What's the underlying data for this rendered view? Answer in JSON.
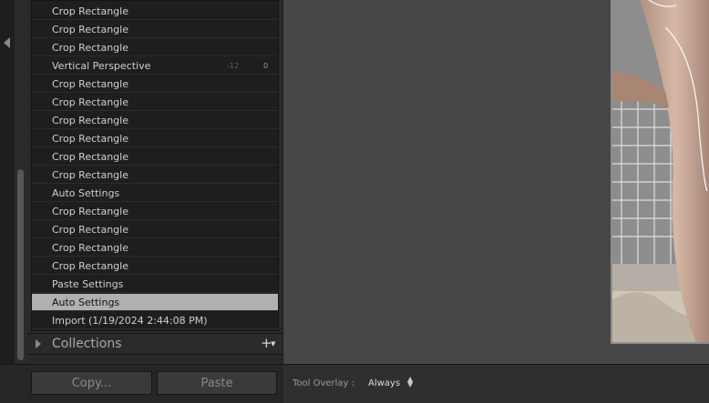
{
  "history": {
    "items": [
      {
        "label": "Crop Rectangle",
        "v1": "",
        "v2": ""
      },
      {
        "label": "Crop Rectangle",
        "v1": "",
        "v2": ""
      },
      {
        "label": "Crop Rectangle",
        "v1": "",
        "v2": ""
      },
      {
        "label": "Vertical Perspective",
        "v1": "-12",
        "v2": "0"
      },
      {
        "label": "Crop Rectangle",
        "v1": "",
        "v2": ""
      },
      {
        "label": "Crop Rectangle",
        "v1": "",
        "v2": ""
      },
      {
        "label": "Crop Rectangle",
        "v1": "",
        "v2": ""
      },
      {
        "label": "Crop Rectangle",
        "v1": "",
        "v2": ""
      },
      {
        "label": "Crop Rectangle",
        "v1": "",
        "v2": ""
      },
      {
        "label": "Crop Rectangle",
        "v1": "",
        "v2": ""
      },
      {
        "label": "Auto Settings",
        "v1": "",
        "v2": ""
      },
      {
        "label": "Crop Rectangle",
        "v1": "",
        "v2": ""
      },
      {
        "label": "Crop Rectangle",
        "v1": "",
        "v2": ""
      },
      {
        "label": "Crop Rectangle",
        "v1": "",
        "v2": ""
      },
      {
        "label": "Crop Rectangle",
        "v1": "",
        "v2": ""
      },
      {
        "label": "Paste Settings",
        "v1": "",
        "v2": ""
      },
      {
        "label": "Auto Settings",
        "v1": "",
        "v2": ""
      },
      {
        "label": "Import (1/19/2024 2:44:08 PM)",
        "v1": "",
        "v2": ""
      }
    ],
    "selected_index": 16
  },
  "collections": {
    "title": "Collections",
    "add_icon": "plus-icon"
  },
  "buttons": {
    "copy": "Copy...",
    "paste": "Paste"
  },
  "toolbar": {
    "tool_overlay_label": "Tool Overlay :",
    "tool_overlay_value": "Always"
  },
  "colors": {
    "selected_row": "#b0b0b0",
    "workspace": "#474747",
    "panel": "#1e1e1e"
  }
}
